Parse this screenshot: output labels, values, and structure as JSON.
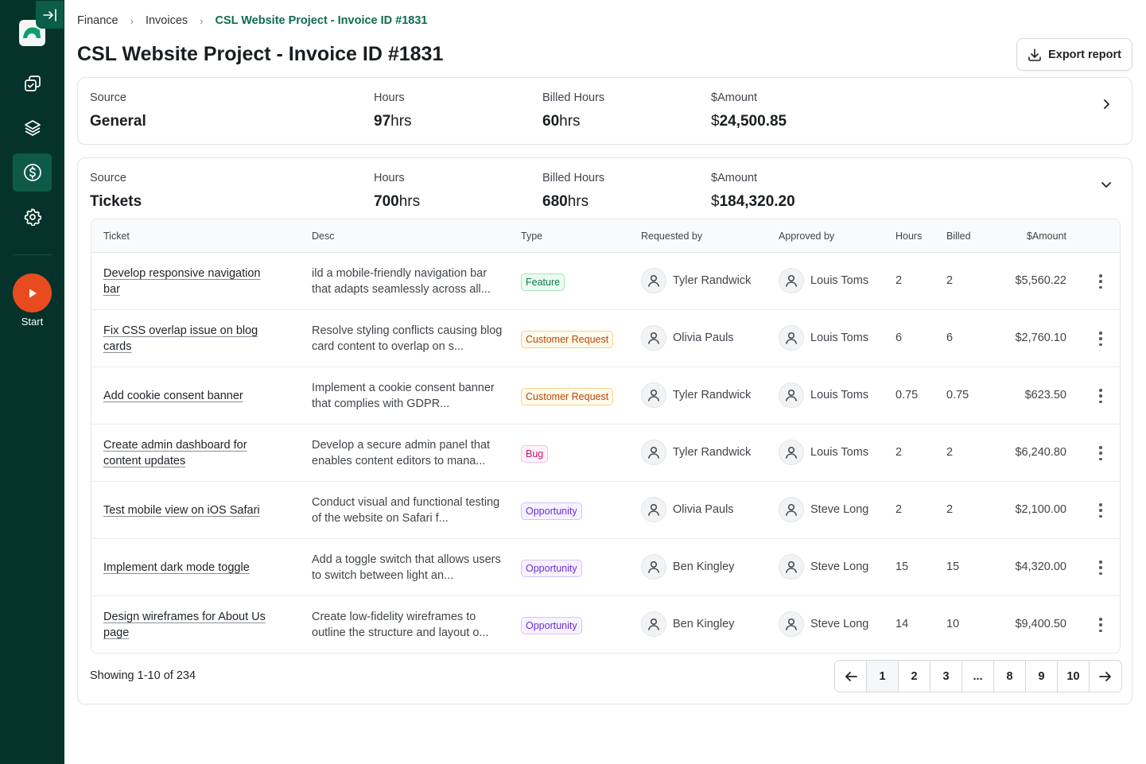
{
  "sidebar": {
    "start_label": "Start",
    "brand_color": "#05332b",
    "accent_color": "#e84c1e"
  },
  "breadcrumb": {
    "items": [
      "Finance",
      "Invoices"
    ],
    "current": "CSL Website Project - Invoice ID #1831"
  },
  "page": {
    "title": "CSL Website Project - Invoice ID #1831",
    "export_label": "Export report"
  },
  "summary_general": {
    "source_label": "Source",
    "source": "General",
    "hours_label": "Hours",
    "hours": "97",
    "hours_unit": "hrs",
    "billed_label": "Billed Hours",
    "billed": "60",
    "billed_unit": "hrs",
    "amount_label": "$Amount",
    "currency": "$",
    "amount": "24,500.85"
  },
  "summary_tickets": {
    "source_label": "Source",
    "source": "Tickets",
    "hours_label": "Hours",
    "hours": "700",
    "hours_unit": "hrs",
    "billed_label": "Billed Hours",
    "billed": "680",
    "billed_unit": "hrs",
    "amount_label": "$Amount",
    "currency": "$",
    "amount": "184,320.20"
  },
  "table": {
    "headers": {
      "ticket": "Ticket",
      "desc": "Desc",
      "type": "Type",
      "requested_by": "Requested by",
      "approved_by": "Approved by",
      "hours": "Hours",
      "billed": "Billed",
      "amount": "$Amount"
    },
    "rows": [
      {
        "ticket": "Develop responsive navigation bar",
        "desc": "ild a mobile-friendly navigation bar that adapts seamlessly across all...",
        "type": "Feature",
        "type_kind": "feature",
        "requested_by": "Tyler Randwick",
        "approved_by": "Louis Toms",
        "hours": "2",
        "billed": "2",
        "amount": "$5,560.22"
      },
      {
        "ticket": "Fix CSS overlap issue on blog cards",
        "desc": "Resolve styling conflicts causing blog card content to overlap on s...",
        "type": "Customer Request",
        "type_kind": "customer",
        "requested_by": "Olivia Pauls",
        "approved_by": "Louis Toms",
        "hours": "6",
        "billed": "6",
        "amount": "$2,760.10"
      },
      {
        "ticket": "Add cookie consent banner",
        "desc": "Implement a cookie consent banner that complies with GDPR...",
        "type": "Customer Request",
        "type_kind": "customer",
        "requested_by": "Tyler Randwick",
        "approved_by": "Louis Toms",
        "hours": "0.75",
        "billed": "0.75",
        "amount": "$623.50"
      },
      {
        "ticket": "Create admin dashboard for content updates",
        "desc": "Develop a secure admin panel that enables content editors to mana...",
        "type": "Bug",
        "type_kind": "bug",
        "requested_by": "Tyler Randwick",
        "approved_by": "Louis Toms",
        "hours": "2",
        "billed": "2",
        "amount": "$6,240.80"
      },
      {
        "ticket": "Test mobile view on iOS Safari",
        "desc": "Conduct visual and functional testing of the website on Safari f...",
        "type": "Opportunity",
        "type_kind": "opportunity",
        "requested_by": "Olivia Pauls",
        "approved_by": "Steve Long",
        "hours": "2",
        "billed": "2",
        "amount": "$2,100.00"
      },
      {
        "ticket": "Implement dark mode toggle",
        "desc": "Add a toggle switch that allows users to switch between light an...",
        "type": "Opportunity",
        "type_kind": "opportunity",
        "requested_by": "Ben Kingley",
        "approved_by": "Steve Long",
        "hours": "15",
        "billed": "15",
        "amount": "$4,320.00"
      },
      {
        "ticket": "Design wireframes for About Us page",
        "desc": "Create low-fidelity wireframes to outline the structure and layout o...",
        "type": "Opportunity",
        "type_kind": "opportunity",
        "requested_by": "Ben Kingley",
        "approved_by": "Steve Long",
        "hours": "14",
        "billed": "10",
        "amount": "$9,400.50"
      }
    ]
  },
  "footer": {
    "showing": "Showing 1-10 of 234",
    "pages": [
      "1",
      "2",
      "3",
      "...",
      "8",
      "9",
      "10"
    ],
    "current_page": "1"
  }
}
